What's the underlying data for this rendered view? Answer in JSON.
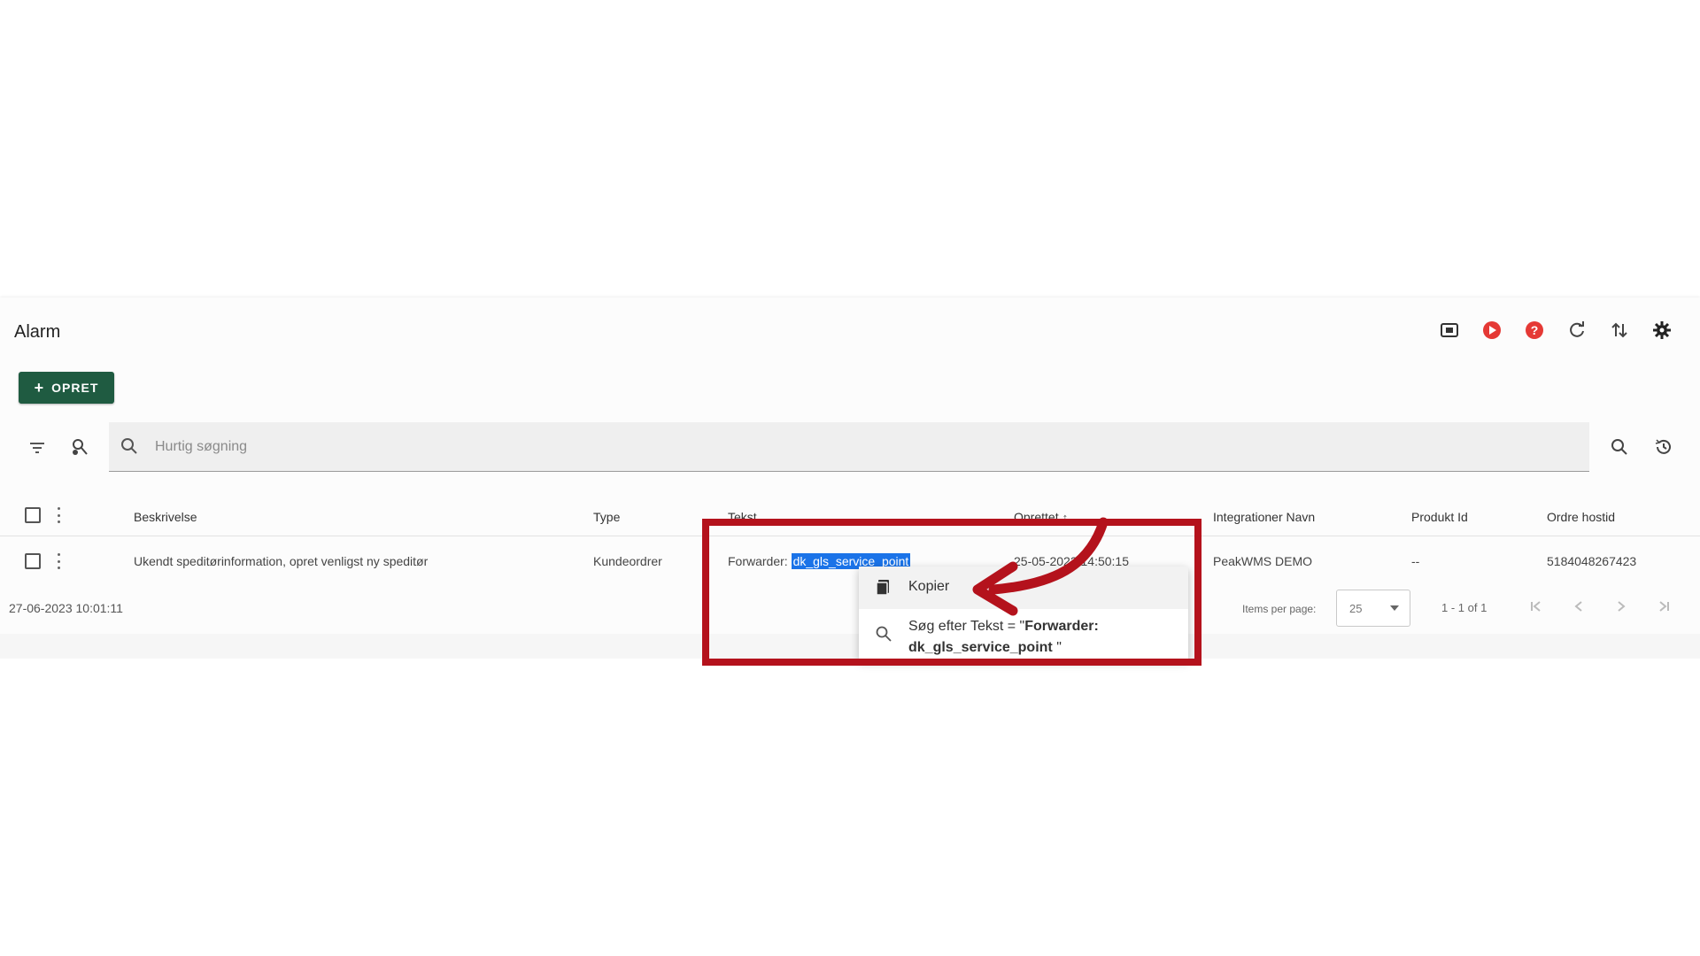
{
  "app": {
    "title": "Alarm",
    "accent_color": "#1f5b41",
    "header_icons": [
      "screen-icon",
      "record-icon",
      "help-icon",
      "refresh-icon",
      "sort-arrows-icon",
      "settings-icon"
    ]
  },
  "toolbar": {
    "create_label": "OPRET"
  },
  "search": {
    "placeholder": "Hurtig søgning"
  },
  "table": {
    "columns": [
      "Beskrivelse",
      "Type",
      "Tekst",
      "Oprettet",
      "Integrationer Navn",
      "Produkt Id",
      "Ordre hostid"
    ],
    "sort_column": "Oprettet",
    "rows": [
      {
        "beskrivelse": "Ukendt speditørinformation, opret venligst ny speditør",
        "type": "Kundeordrer",
        "tekst_prefix": "Forwarder:",
        "tekst_selected": "dk_gls_service_point",
        "oprettet": "25-05-2023 14:50:15",
        "integrationer_navn": "PeakWMS DEMO",
        "produkt_id": "--",
        "ordre_hostid": "5184048267423"
      }
    ]
  },
  "footer": {
    "timestamp": "27-06-2023 10:01:11",
    "items_per_page_label": "Items per page:",
    "items_per_page_value": "25",
    "range_label": "1 - 1 of 1"
  },
  "context_menu": {
    "copy_label": "Kopier",
    "search_prefix": "Søg efter Tekst = \"",
    "search_value": "Forwarder: dk_gls_service_point",
    "search_suffix": " \""
  },
  "annotation": {
    "frame_color": "#b4121c"
  }
}
